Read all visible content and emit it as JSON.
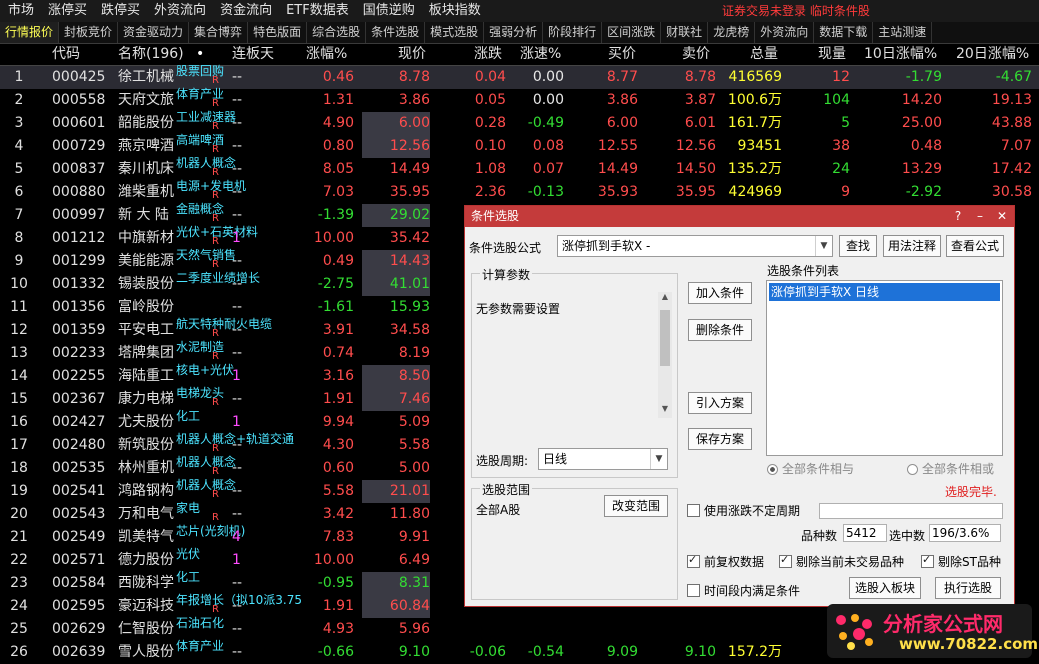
{
  "menubar": {
    "items": [
      "市场",
      "涨停买",
      "跌停买",
      "外资流向",
      "资金流向",
      "ETF数据表",
      "国债逆购",
      "板块指数"
    ],
    "warning": "证券交易未登录   临时条件股"
  },
  "tabs": [
    "行情报价",
    "封板竞价",
    "资金驱动力",
    "集合博弈",
    "特色版面",
    "综合选股",
    "条件选股",
    "模式选股",
    "强弱分析",
    "阶段排行",
    "区间涨跌",
    "财联社",
    "龙虎榜",
    "外资流向",
    "数据下载",
    "主站测速"
  ],
  "columns": {
    "code": "代码",
    "name": "名称(196)",
    "name_dot": "•",
    "days": "连板天",
    "pct": "涨幅%",
    "price": "现价",
    "chg": "涨跌",
    "spd": "涨速%",
    "buy": "买价",
    "sell": "卖价",
    "vol": "总量",
    "cur": "现量",
    "p10": "10日涨幅%",
    "p20": "20日涨幅%"
  },
  "rows": [
    {
      "idx": "1",
      "code": "000425",
      "name": "徐工机械",
      "tag": "股票回购",
      "r": "R",
      "days": "--",
      "pct": "0.46",
      "price": "8.78",
      "chg": "0.04",
      "spd": "0.00",
      "buy": "8.77",
      "sell": "8.78",
      "vol": "416569",
      "cur": "12",
      "p10": "-1.79",
      "p20": "-4.67",
      "dir": "red",
      "curdir": "red",
      "p10dir": "green",
      "p20dir": "green",
      "boxed": false
    },
    {
      "idx": "2",
      "code": "000558",
      "name": "天府文旅",
      "tag": "体育产业",
      "r": "R",
      "days": "--",
      "pct": "1.31",
      "price": "3.86",
      "chg": "0.05",
      "spd": "0.00",
      "buy": "3.86",
      "sell": "3.87",
      "vol": "100.6万",
      "cur": "104",
      "p10": "14.20",
      "p20": "19.13",
      "dir": "red",
      "curdir": "green",
      "p10dir": "red",
      "p20dir": "red",
      "boxed": false
    },
    {
      "idx": "3",
      "code": "000601",
      "name": "韶能股份",
      "tag": "工业减速器",
      "r": "R",
      "days": "--",
      "pct": "4.90",
      "price": "6.00",
      "chg": "0.28",
      "spd": "-0.49",
      "buy": "6.00",
      "sell": "6.01",
      "vol": "161.7万",
      "cur": "5",
      "p10": "25.00",
      "p20": "43.88",
      "dir": "red",
      "curdir": "green",
      "p10dir": "red",
      "p20dir": "red",
      "boxed": true
    },
    {
      "idx": "4",
      "code": "000729",
      "name": "燕京啤酒",
      "tag": "高端啤酒",
      "r": "R",
      "days": "--",
      "pct": "0.80",
      "price": "12.56",
      "chg": "0.10",
      "spd": "0.08",
      "buy": "12.55",
      "sell": "12.56",
      "vol": "93451",
      "cur": "38",
      "p10": "0.48",
      "p20": "7.07",
      "dir": "red",
      "curdir": "red",
      "p10dir": "red",
      "p20dir": "red",
      "boxed": true
    },
    {
      "idx": "5",
      "code": "000837",
      "name": "秦川机床",
      "tag": "机器人概念",
      "r": "R",
      "days": "--",
      "pct": "8.05",
      "price": "14.49",
      "chg": "1.08",
      "spd": "0.07",
      "buy": "14.49",
      "sell": "14.50",
      "vol": "135.2万",
      "cur": "24",
      "p10": "13.29",
      "p20": "17.42",
      "dir": "red",
      "curdir": "green",
      "p10dir": "red",
      "p20dir": "red",
      "boxed": false
    },
    {
      "idx": "6",
      "code": "000880",
      "name": "潍柴重机",
      "tag": "电源+发电机",
      "r": "R",
      "days": "--",
      "pct": "7.03",
      "price": "35.95",
      "chg": "2.36",
      "spd": "-0.13",
      "buy": "35.93",
      "sell": "35.95",
      "vol": "424969",
      "cur": "9",
      "p10": "-2.92",
      "p20": "30.58",
      "dir": "red",
      "curdir": "red",
      "p10dir": "green",
      "p20dir": "red",
      "boxed": false
    },
    {
      "idx": "7",
      "code": "000997",
      "name": "新 大 陆",
      "tag": "金融概念",
      "r": "R",
      "days": "--",
      "pct": "-1.39",
      "price": "29.02",
      "dir": "green",
      "boxed": true
    },
    {
      "idx": "8",
      "code": "001212",
      "name": "中旗新材",
      "tag": "光伏+石英材料",
      "r": "R",
      "days": "1",
      "pct": "10.00",
      "price": "35.42",
      "dir": "red",
      "boxed": false
    },
    {
      "idx": "9",
      "code": "001299",
      "name": "美能能源",
      "tag": "天然气销售",
      "r": "R",
      "days": "--",
      "pct": "0.49",
      "price": "14.43",
      "dir": "red",
      "boxed": true
    },
    {
      "idx": "10",
      "code": "001332",
      "name": "锡装股份",
      "tag": "二季度业绩增长",
      "r": "",
      "days": "--",
      "pct": "-2.75",
      "price": "41.01",
      "dir": "green",
      "boxed": true
    },
    {
      "idx": "11",
      "code": "001356",
      "name": "富岭股份",
      "tag": "",
      "r": "",
      "days": "--",
      "pct": "-1.61",
      "price": "15.93",
      "dir": "green",
      "boxed": false
    },
    {
      "idx": "12",
      "code": "001359",
      "name": "平安电工",
      "tag": "航天特种耐火电缆",
      "r": "R",
      "days": "--",
      "pct": "3.91",
      "price": "34.58",
      "dir": "red",
      "boxed": false
    },
    {
      "idx": "13",
      "code": "002233",
      "name": "塔牌集团",
      "tag": "水泥制造",
      "r": "R",
      "days": "--",
      "pct": "0.74",
      "price": "8.19",
      "dir": "red",
      "boxed": false
    },
    {
      "idx": "14",
      "code": "002255",
      "name": "海陆重工",
      "tag": "核电+光伏",
      "r": "",
      "days": "1",
      "pct": "3.16",
      "price": "8.50",
      "dir": "red",
      "boxed": true
    },
    {
      "idx": "15",
      "code": "002367",
      "name": "康力电梯",
      "tag": "电梯龙头",
      "r": "R",
      "days": "--",
      "pct": "1.91",
      "price": "7.46",
      "dir": "red",
      "boxed": true
    },
    {
      "idx": "16",
      "code": "002427",
      "name": "尤夫股份",
      "tag": "化工",
      "r": "",
      "days": "1",
      "pct": "9.94",
      "price": "5.09",
      "dir": "red",
      "boxed": false
    },
    {
      "idx": "17",
      "code": "002480",
      "name": "新筑股份",
      "tag": "机器人概念+轨道交通",
      "r": "R",
      "days": "--",
      "pct": "4.30",
      "price": "5.58",
      "dir": "red",
      "boxed": false
    },
    {
      "idx": "18",
      "code": "002535",
      "name": "林州重机",
      "tag": "机器人概念",
      "r": "R",
      "days": "--",
      "pct": "0.60",
      "price": "5.00",
      "dir": "red",
      "boxed": false
    },
    {
      "idx": "19",
      "code": "002541",
      "name": "鸿路钢构",
      "tag": "机器人概念",
      "r": "R",
      "days": "--",
      "pct": "5.58",
      "price": "21.01",
      "dir": "red",
      "boxed": true
    },
    {
      "idx": "20",
      "code": "002543",
      "name": "万和电气",
      "tag": "家电",
      "r": "R",
      "days": "--",
      "pct": "3.42",
      "price": "11.80",
      "dir": "red",
      "boxed": false
    },
    {
      "idx": "21",
      "code": "002549",
      "name": "凯美特气",
      "tag": "芯片(光刻机)",
      "r": "",
      "days": "4",
      "pct": "7.83",
      "price": "9.91",
      "dir": "red",
      "boxed": false
    },
    {
      "idx": "22",
      "code": "002571",
      "name": "德力股份",
      "tag": "光伏",
      "r": "",
      "days": "1",
      "pct": "10.00",
      "price": "6.49",
      "dir": "red",
      "boxed": false
    },
    {
      "idx": "23",
      "code": "002584",
      "name": "西陇科学",
      "tag": "化工",
      "r": "",
      "days": "--",
      "pct": "-0.95",
      "price": "8.31",
      "dir": "green",
      "boxed": true
    },
    {
      "idx": "24",
      "code": "002595",
      "name": "豪迈科技",
      "tag": "年报增长（拟10派3.75",
      "r": "R",
      "days": "--",
      "pct": "1.91",
      "price": "60.84",
      "dir": "red",
      "boxed": true
    },
    {
      "idx": "25",
      "code": "002629",
      "name": "仁智股份",
      "tag": "石油石化",
      "r": "",
      "days": "--",
      "pct": "4.93",
      "price": "5.96",
      "dir": "red",
      "boxed": false
    },
    {
      "idx": "26",
      "code": "002639",
      "name": "雪人股份",
      "tag": "体育产业",
      "r": "",
      "days": "--",
      "pct": "-0.66",
      "price": "9.10",
      "chg": "-0.06",
      "spd": "-0.54",
      "buy": "9.09",
      "sell": "9.10",
      "vol": "157.2万",
      "cur": "",
      "p10": "",
      "p20": "",
      "dir": "green",
      "curdir": "red",
      "p10dir": "red",
      "p20dir": "red",
      "boxed": false
    }
  ],
  "dialog": {
    "title": "条件选股",
    "formula_label": "条件选股公式",
    "formula_value": "涨停抓到手软X  -",
    "btn_find": "查找",
    "btn_usage": "用法注释",
    "btn_view": "查看公式",
    "params_group": "计算参数",
    "params_text": "无参数需要设置",
    "period_label": "选股周期:",
    "period_value": "日线",
    "btn_add": "加入条件",
    "btn_delete": "删除条件",
    "btn_import": "引入方案",
    "btn_save": "保存方案",
    "list_label": "选股条件列表",
    "list_items": [
      "涨停抓到手软X  日线"
    ],
    "radio_and": "全部条件相与",
    "radio_or": "全部条件相或",
    "status": "选股完毕.",
    "scope_group": "选股范围",
    "scope_text": "全部A股",
    "btn_scope": "改变范围",
    "use_period": "使用涨跌不定周期",
    "count_label": "品种数",
    "count_value": "5412",
    "selected_label": "选中数",
    "selected_value": "196/3.6%",
    "cb_qfq": "前复权数据",
    "cb_remove_notrade": "剔除当前未交易品种",
    "cb_remove_st": "剔除ST品种",
    "cb_time": "时间段内满足条件",
    "btn_to_block": "选股入板块",
    "btn_execute": "执行选股"
  },
  "logo": {
    "line1": "分析家公式网",
    "line2": "www.70822.com"
  }
}
